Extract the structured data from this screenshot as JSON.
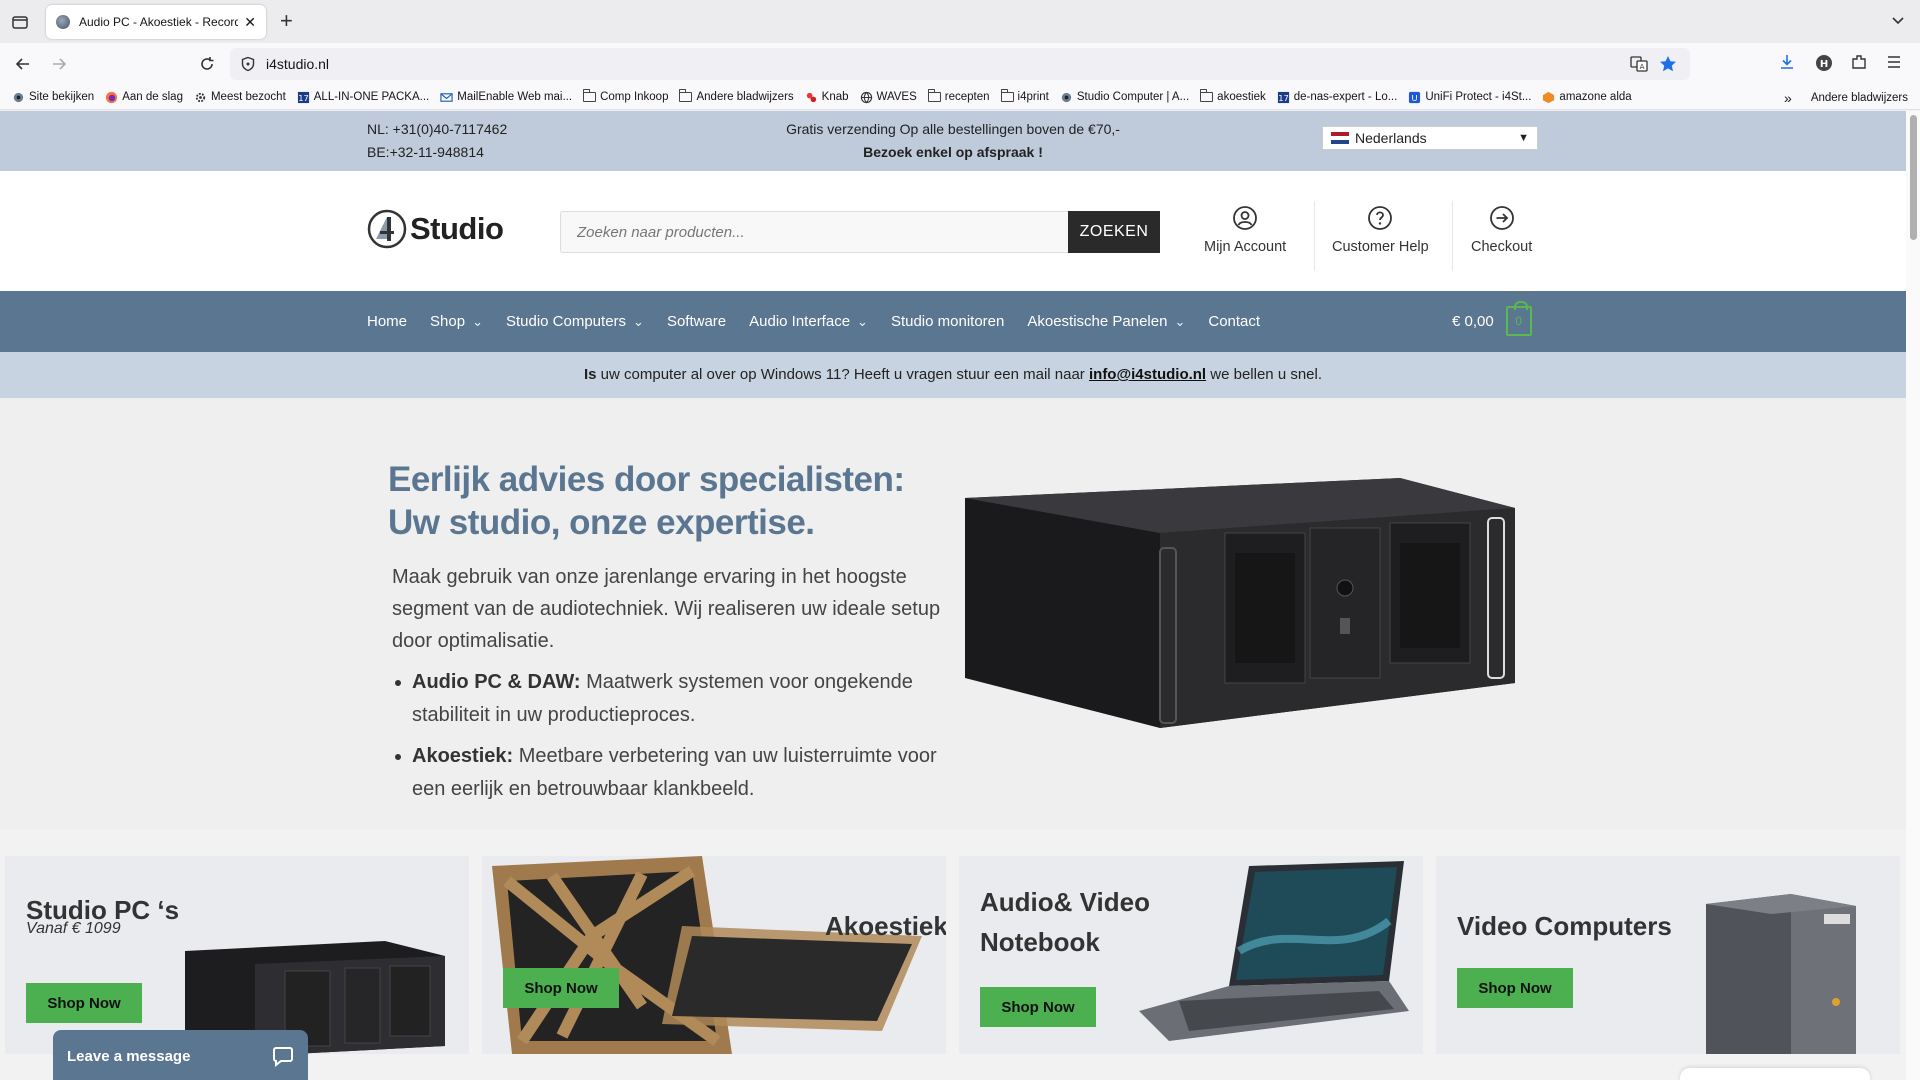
{
  "browser": {
    "tab_title": "Audio PC - Akoestiek - Recording",
    "url": "i4studio.nl",
    "bookmarks": [
      {
        "label": "Site bekijken",
        "icon": "site-icon"
      },
      {
        "label": "Aan de slag",
        "icon": "firefox-icon"
      },
      {
        "label": "Meest bezocht",
        "icon": "gear-icon"
      },
      {
        "label": "ALL-IN-ONE PACKA...",
        "icon": "app-icon"
      },
      {
        "label": "MailEnable Web mai...",
        "icon": "mail-icon"
      },
      {
        "label": "Comp Inkoop",
        "icon": "folder-icon"
      },
      {
        "label": "Andere bladwijzers",
        "icon": "folder-icon"
      },
      {
        "label": "Knab",
        "icon": "knab-icon"
      },
      {
        "label": "WAVES",
        "icon": "globe-icon"
      },
      {
        "label": "recepten",
        "icon": "folder-icon"
      },
      {
        "label": "i4print",
        "icon": "folder-icon"
      },
      {
        "label": "Studio Computer | A...",
        "icon": "site-icon"
      },
      {
        "label": "akoestiek",
        "icon": "folder-icon"
      },
      {
        "label": "de-nas-expert - Lo...",
        "icon": "app-icon"
      },
      {
        "label": "UniFi Protect - i4St...",
        "icon": "unifi-icon"
      },
      {
        "label": "amazone alda",
        "icon": "amazon-icon"
      }
    ],
    "other_bookmarks": "Andere bladwijzers"
  },
  "topbar": {
    "phone_nl": "NL: +31(0)40-7117462",
    "phone_be": "BE:+32-11-948814",
    "shipping": "Gratis verzending Op alle bestellingen boven de €70,-",
    "appointment": "Bezoek enkel op afspraak !",
    "language": "Nederlands"
  },
  "header": {
    "logo_text": "Studio",
    "search_placeholder": "Zoeken naar producten...",
    "search_button": "ZOEKEN",
    "links": [
      {
        "label": "Mijn Account",
        "icon": "user-icon"
      },
      {
        "label": "Customer Help",
        "icon": "help-icon"
      },
      {
        "label": "Checkout",
        "icon": "arrow-circle-icon"
      }
    ]
  },
  "menu": {
    "items": [
      {
        "label": "Home",
        "dropdown": false
      },
      {
        "label": "Shop",
        "dropdown": true
      },
      {
        "label": "Studio Computers",
        "dropdown": true
      },
      {
        "label": "Software",
        "dropdown": false
      },
      {
        "label": "Audio Interface",
        "dropdown": true
      },
      {
        "label": "Studio monitoren",
        "dropdown": false
      },
      {
        "label": "Akoestische Panelen",
        "dropdown": true
      },
      {
        "label": "Contact",
        "dropdown": false
      }
    ],
    "cart_total": "€ 0,00",
    "cart_count": "0"
  },
  "notice": {
    "lead": "Is",
    "text": " uw computer al over op Windows 11? Heeft u vragen stuur een mail naar ",
    "email": "info@i4studio.nl",
    "tail": " we bellen u snel."
  },
  "hero": {
    "title": "Eerlijk advies door specialisten: Uw studio, onze expertise.",
    "intro": "Maak gebruik van onze jarenlange ervaring in het hoogste segment van de audiotechniek. Wij realiseren uw ideale setup door optimalisatie.",
    "bullets": [
      {
        "label": "Audio PC & DAW:",
        "text": " Maatwerk systemen voor ongekende stabiliteit in uw productieproces."
      },
      {
        "label": "Akoestiek:",
        "text": " Meetbare verbetering van uw luisterruimte voor een eerlijk en betrouwbaar klankbeeld."
      }
    ]
  },
  "cards": [
    {
      "title": "Studio PC ‘s",
      "subtitle": "Vanaf € 1099",
      "button": "Shop Now"
    },
    {
      "title": "Akoestiek",
      "button": "Shop Now"
    },
    {
      "title": "Audio& Video Notebook",
      "button": "Shop Now"
    },
    {
      "title": "Video Computers",
      "button": "Shop Now"
    }
  ],
  "chat": {
    "label": "Leave a message"
  },
  "colors": {
    "brand_blue": "#5a7691",
    "top_strip": "#bfcbdb",
    "notice_bg": "#c7d3e1",
    "shop_green": "#4caf50"
  }
}
